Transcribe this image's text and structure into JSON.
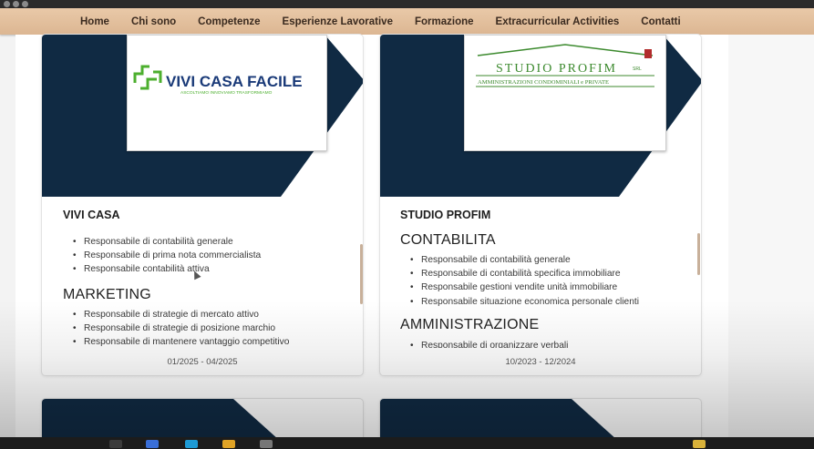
{
  "nav": {
    "items": [
      "Home",
      "Chi sono",
      "Competenze",
      "Esperienze Lavorative",
      "Formazione",
      "Extracurricular Activities",
      "Contatti"
    ]
  },
  "cards": [
    {
      "logo_title": "VIVI CASA FACILE",
      "logo_tagline": "ASCOLTIAMO INNOVIAMO TRASFORMIAMO",
      "company": "VIVI CASA",
      "sections": [
        {
          "title": "",
          "items": [
            "Responsabile di contabilità generale",
            "Responsabile di prima nota commercialista",
            "Responsabile contabilità attiva"
          ]
        },
        {
          "title": "MARKETING",
          "items": [
            "Responsabile di strategie di mercato attivo",
            "Responsabile di strategie di posizione marchio",
            "Responsabile di mantenere vantaggio competitivo"
          ]
        }
      ],
      "dates": "01/2025 - 04/2025"
    },
    {
      "logo_title": "STUDIO PROFIM",
      "logo_suffix": "SRL",
      "logo_subtitle": "AMMINISTRAZIONI CONDOMINIALI e PRIVATE",
      "company": "STUDIO PROFIM",
      "sections": [
        {
          "title": "CONTABILITA",
          "items": [
            "Responsabile di contabilità generale",
            "Responsabile di contabilità specifica immobiliare",
            "Responsabile gestioni vendite unità immobiliare",
            "Responsabile situazione economica personale clienti"
          ]
        },
        {
          "title": "AMMINISTRAZIONE",
          "items": [
            "Responsabile di organizzare verbali"
          ]
        }
      ],
      "dates": "10/2023 - 12/2024"
    }
  ],
  "colors": {
    "navy": "#102a43",
    "nav_bg": "#dcb692",
    "logo_green": "#3c8a2e",
    "logo_blue": "#1a3a78"
  }
}
